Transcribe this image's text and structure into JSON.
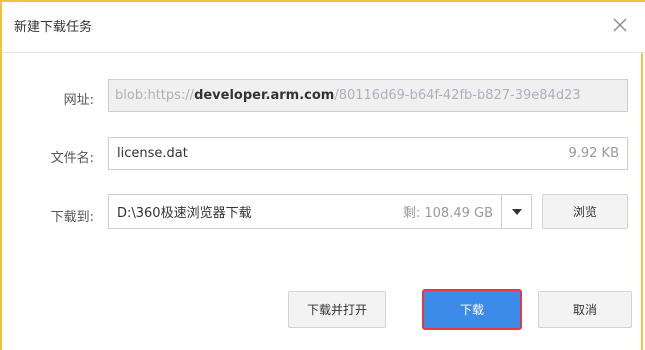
{
  "dialog": {
    "title": "新建下载任务"
  },
  "fields": {
    "url_label": "网址:",
    "url_prefix": "blob:https://",
    "url_host": "developer.arm.com",
    "url_suffix": "/80116d69-b64f-42fb-b827-39e84d23",
    "filename_label": "文件名:",
    "filename_value": "license.dat",
    "file_size": "9.92 KB",
    "saveto_label": "下载到:",
    "saveto_path": "D:\\360极速浏览器下载",
    "free_space": "剩: 108.49 GB",
    "browse_label": "浏览"
  },
  "buttons": {
    "download_open": "下载并打开",
    "download": "下载",
    "cancel": "取消"
  },
  "colors": {
    "border_accent": "#f2c23a",
    "primary": "#3d8be8",
    "highlight": "#e33b3b"
  }
}
